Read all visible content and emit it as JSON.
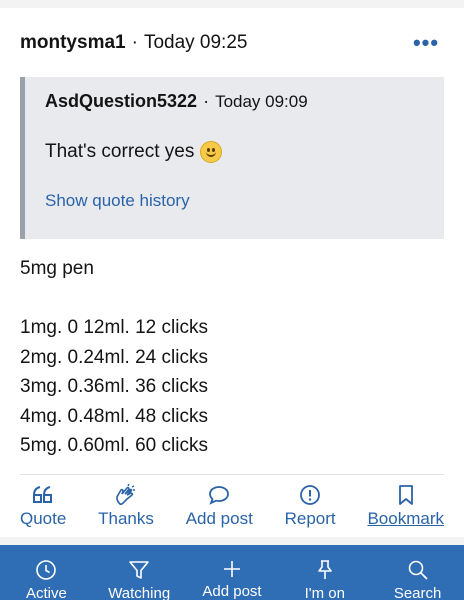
{
  "post": {
    "author": "montysma1",
    "separator": "·",
    "timestamp": "Today 09:25",
    "more_label": "•••"
  },
  "quote": {
    "author": "AsdQuestion5322",
    "separator": "·",
    "timestamp": "Today 09:09",
    "text": "That's correct yes",
    "emoji": "slightly-smiling-face",
    "history_link": "Show quote history"
  },
  "body_lines": [
    "5mg pen",
    "",
    "1mg. 0 12ml. 12 clicks",
    "2mg. 0.24ml. 24 clicks",
    "3mg. 0.36ml. 36 clicks",
    "4mg. 0.48ml. 48 clicks",
    "5mg. 0.60ml. 60 clicks"
  ],
  "actions": [
    {
      "label": "Quote",
      "icon": "quote-icon"
    },
    {
      "label": "Thanks",
      "icon": "clapping-hands-icon"
    },
    {
      "label": "Add post",
      "icon": "speech-bubble-icon"
    },
    {
      "label": "Report",
      "icon": "alert-circle-icon"
    },
    {
      "label": "Bookmark",
      "icon": "bookmark-icon"
    }
  ],
  "bottom_nav": [
    {
      "label": "Active",
      "icon": "clock-icon"
    },
    {
      "label": "Watching",
      "icon": "filter-icon"
    },
    {
      "label": "Add post",
      "icon": "plus-icon"
    },
    {
      "label": "I'm on",
      "icon": "pin-icon"
    },
    {
      "label": "Search",
      "icon": "search-icon"
    }
  ],
  "colors": {
    "link": "#2a63a8",
    "nav_background": "#2f6db5",
    "quote_background": "#e9eaee",
    "quote_border": "#9aa1ab"
  }
}
